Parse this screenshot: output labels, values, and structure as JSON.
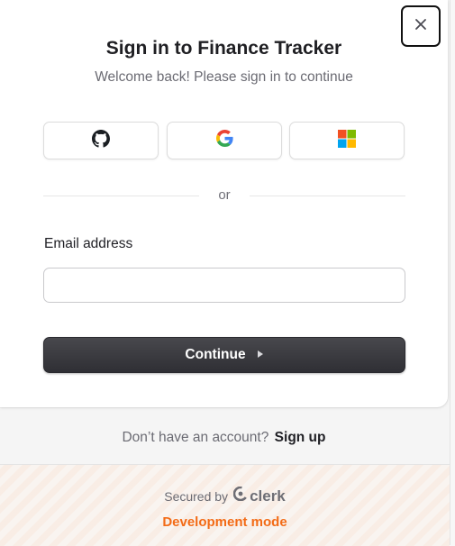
{
  "dialog": {
    "close_icon": "close-icon",
    "title": "Sign in to Finance Tracker",
    "subtitle": "Welcome back! Please sign in to continue"
  },
  "social": [
    {
      "provider": "github",
      "icon": "github-icon"
    },
    {
      "provider": "google",
      "icon": "google-icon"
    },
    {
      "provider": "microsoft",
      "icon": "microsoft-icon"
    }
  ],
  "divider": {
    "text": "or"
  },
  "form": {
    "email_label": "Email address",
    "email_value": "",
    "email_placeholder": "",
    "continue_label": "Continue",
    "continue_icon": "triangle-right-icon"
  },
  "signup": {
    "prompt": "Don’t have an account?",
    "link": "Sign up"
  },
  "footer": {
    "secured_by": "Secured by",
    "brand": "clerk",
    "dev_mode": "Development mode"
  },
  "colors": {
    "accent": "#f36b16",
    "primary_button": "#2f2f34",
    "muted_text": "#6b6b73"
  }
}
